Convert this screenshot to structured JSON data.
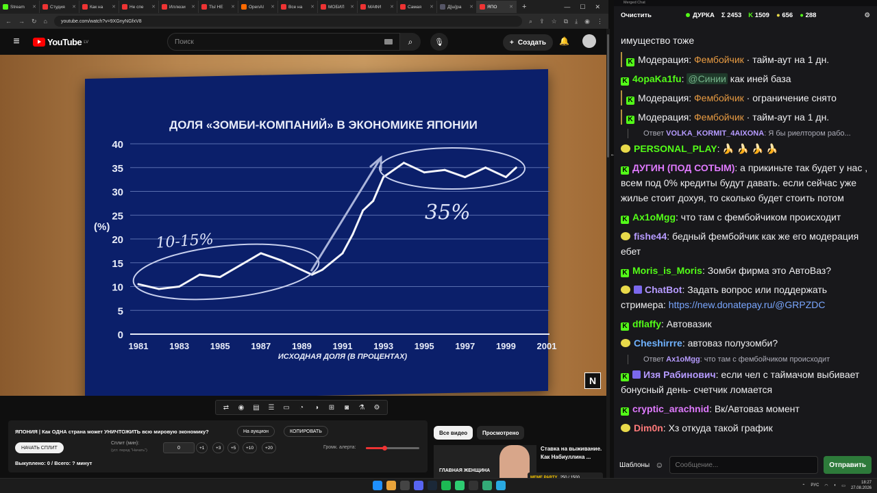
{
  "browser": {
    "tabs": [
      {
        "label": "Stream",
        "color": "k"
      },
      {
        "label": "Студия",
        "color": "r"
      },
      {
        "label": "Как на",
        "color": "r"
      },
      {
        "label": "Не спе",
        "color": "r"
      },
      {
        "label": "Иллюзи",
        "color": "r"
      },
      {
        "label": "ТЫ НЕ",
        "color": "r"
      },
      {
        "label": "OpenAI",
        "color": "o"
      },
      {
        "label": "Все на",
        "color": "r"
      },
      {
        "label": "МОБИЛ",
        "color": "r"
      },
      {
        "label": "МАФИ",
        "color": "r"
      },
      {
        "label": "Самая",
        "color": "r"
      },
      {
        "label": "Д[ш]ра",
        "color": "a"
      },
      {
        "label": "ЯПО",
        "color": "r"
      }
    ],
    "url": "youtube.com/watch?v=9XGnyNGfxV8"
  },
  "youtube": {
    "logo": "YouTube",
    "region": "LV",
    "search_placeholder": "Поиск",
    "create_label": "Создать"
  },
  "chart_data": {
    "type": "line",
    "title": "ДОЛЯ «ЗОМБИ-КОМПАНИЙ» В ЭКОНОМИКЕ ЯПОНИИ",
    "ylabel": "(%)",
    "xlabel": "ИСХОДНАЯ ДОЛЯ (В ПРОЦЕНТАХ)",
    "ylim": [
      0,
      40
    ],
    "yticks": [
      0,
      5,
      10,
      15,
      20,
      25,
      30,
      35,
      40
    ],
    "xticks": [
      1981,
      1983,
      1985,
      1987,
      1989,
      1991,
      1993,
      1995,
      1997,
      1999,
      2001
    ],
    "grid": true,
    "x": [
      1981,
      1982,
      1983,
      1984,
      1985,
      1986,
      1987,
      1988,
      1989,
      1989.5,
      1990,
      1991,
      1991.5,
      1992,
      1992.5,
      1993,
      1994,
      1995,
      1996,
      1997,
      1998,
      1999,
      1999.5
    ],
    "values": [
      10.5,
      9.5,
      10,
      12.5,
      12,
      14.5,
      17,
      15.5,
      13.5,
      12.5,
      13.5,
      17,
      21,
      26,
      28,
      33,
      36,
      34,
      34.5,
      33,
      35,
      33,
      35
    ],
    "annotations": [
      "10-15%",
      "35%"
    ]
  },
  "player_controls": [
    "repeat",
    "podcast",
    "subtitles",
    "chapters",
    "miniplayer",
    "timer",
    "speed",
    "screenshot",
    "camera",
    "flask",
    "settings"
  ],
  "stream_panel": {
    "title": "ЯПОНИЯ | Как ОДНА страна может УНИЧТОЖИТЬ всю мировую экономику?",
    "auction_label": "На аукцион",
    "copy_label": "КОПИРОВАТЬ",
    "start_split_label": "НАЧАТЬ СПЛИТ",
    "split_label": "Сплит (мин):",
    "split_hint": "(уст. перед \"Начать\")",
    "split_value": "0",
    "increments": [
      "+1",
      "+3",
      "+5",
      "+10",
      "+20"
    ],
    "volume_label": "Громк. алерта:",
    "volume_level": 0.35,
    "bought": "Выкуплено: 0 / Всего: ? минут"
  },
  "recommendations": {
    "filter_all": "Все видео",
    "filter_watched": "Просмотрено",
    "thumb_caption": "ГЛАВНАЯ ЖЕНЩИНА",
    "video_title": "Ставка на выживание. Как Набиуллина ...",
    "badge_tag": "MEME PARTY",
    "badge_count": "250 / 1500"
  },
  "chat": {
    "window_title": "Merged Chat",
    "clear_label": "Очистить",
    "channel": "ДУРКА",
    "totals": {
      "sum": "Σ 2453",
      "kick": "1509",
      "bee": "656",
      "other": "288"
    },
    "messages": [
      {
        "kind": "text",
        "text": "имущество тоже"
      },
      {
        "kind": "mod",
        "prefix": "Модерация:",
        "target": "Фембойчик",
        "action": "· тайм-аут на 1 дн."
      },
      {
        "kind": "msg",
        "icon": "k",
        "name": "4opaKa1fu",
        "name_color": "#53fc18",
        "mention": "@Синии",
        "text": "как иней база"
      },
      {
        "kind": "mod",
        "prefix": "Модерация:",
        "target": "Фембойчик",
        "action": "· ограничение снято"
      },
      {
        "kind": "mod",
        "prefix": "Модерация:",
        "target": "Фембойчик",
        "action": "· тайм-аут на 1 дн."
      },
      {
        "kind": "reply",
        "prefix": "Ответ",
        "name": "VOLKA_KORMIT_4AIXONA",
        "text": ": Я бы риелтором рабо..."
      },
      {
        "kind": "msg",
        "icon": "bee",
        "name": "PERSONAL_PLAY",
        "name_color": "#53fc18",
        "text": "🍌 🍌 🍌 🍌"
      },
      {
        "kind": "msg",
        "icon": "k",
        "name": "ДУГИН (ПОД СОТЫМ)",
        "name_color": "#e07aff",
        "text": "а прикиньте так будет у нас , всем под 0% кредиты будут давать. если сейчас уже жилье стоит дохуя, то сколько будет стоить потом"
      },
      {
        "kind": "msg",
        "icon": "k",
        "name": "Ax1oMgg",
        "name_color": "#53fc18",
        "text": "что там с фембойчиком происходит"
      },
      {
        "kind": "msg",
        "icon": "bee",
        "name": "fishe44",
        "name_color": "#b69bff",
        "text": "бедный фембойчик как же его модерация ебет"
      },
      {
        "kind": "msg",
        "icon": "k",
        "name": "Moris_is_Moris",
        "name_color": "#53fc18",
        "text": "Зомби фирма это АвтоВаз?"
      },
      {
        "kind": "msg",
        "icon": "bot",
        "name": "ChatBot",
        "name_color": "#b69bff",
        "text": "Задать вопрос или поддержать стримера: ",
        "link": "https://new.donatepay.ru/@GRPZDC"
      },
      {
        "kind": "msg",
        "icon": "k",
        "name": "dflaffy",
        "name_color": "#53fc18",
        "text": "Автовазик"
      },
      {
        "kind": "msg",
        "icon": "bee",
        "name": "Cheshirrre",
        "name_color": "#6fb2ff",
        "text": "автоваз полузомби?"
      },
      {
        "kind": "reply",
        "prefix": "Ответ",
        "name": "Ax1oMgg",
        "text": ": что там с фембойчиком происходит"
      },
      {
        "kind": "msg",
        "icon": "k2",
        "name": "Изя Рабинович",
        "name_color": "#b69bff",
        "text": "если чел с таймачом выбивает бонусный день- счетчик ломается"
      },
      {
        "kind": "msg",
        "icon": "k",
        "name": "cryptic_arachnid",
        "name_color": "#e07aff",
        "text": "Вк/Автоваз момент"
      },
      {
        "kind": "msg",
        "icon": "bee",
        "name": "Dim0n",
        "name_color": "#ff7a7a",
        "text": "Хз откуда такой график"
      }
    ],
    "templates_label": "Шаблоны",
    "input_placeholder": "Сообщение...",
    "send_label": "Отправить"
  },
  "taskbar": {
    "lang": "РУС",
    "time": "18:27",
    "date": "27.08.2026"
  }
}
